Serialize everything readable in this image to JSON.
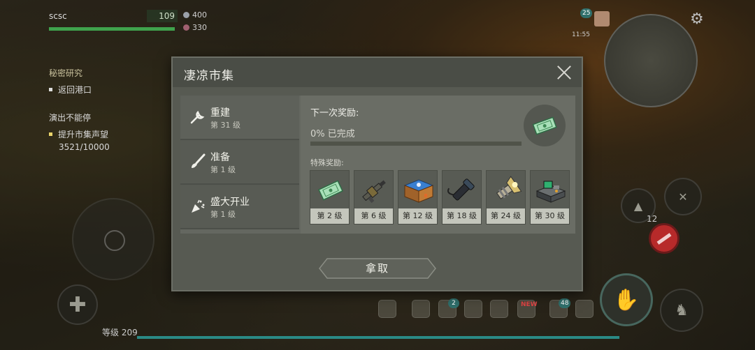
{
  "hud": {
    "player_name": "scsc",
    "health": "109",
    "resource_1": "400",
    "resource_2": "330",
    "quests": [
      {
        "title": "秘密研究",
        "task": "返回港口"
      },
      {
        "title": "演出不能停",
        "task": "提升市集声望",
        "progress": "3521/10000"
      }
    ],
    "promo_badge": "25",
    "promo_timer": "11:55",
    "settings_badge": "",
    "ammo_count": "12",
    "bottom_badges": {
      "mail": "2",
      "event": "NEW",
      "journal": "48"
    },
    "player_level": "等级 209"
  },
  "dialog": {
    "title": "凄凉市集",
    "tabs": [
      {
        "name": "重建",
        "level": "第 31 级",
        "icon": "wrench-icon"
      },
      {
        "name": "准备",
        "level": "第 1 级",
        "icon": "brush-icon"
      },
      {
        "name": "盛大开业",
        "level": "第 1 级",
        "icon": "party-popper-icon"
      }
    ],
    "next_reward_label": "下一次奖励:",
    "progress_text": "0% 已完成",
    "progress_fraction": 0,
    "special_rewards_label": "特殊奖励:",
    "rewards": [
      {
        "level": "第 2 级",
        "icon": "ticket-icon"
      },
      {
        "level": "第 6 级",
        "icon": "grenade-launcher-icon"
      },
      {
        "level": "第 12 级",
        "icon": "blue-crate-icon"
      },
      {
        "level": "第 18 级",
        "icon": "flashlight-icon"
      },
      {
        "level": "第 24 级",
        "icon": "spotlight-icon"
      },
      {
        "level": "第 30 级",
        "icon": "workbench-icon"
      }
    ],
    "take_button": "拿取"
  },
  "colors": {
    "dialog_bg": "#575a52",
    "progress_fill": "#d0c060",
    "health": "#3fa34d",
    "xp": "#2a8a86",
    "danger": "#b72a2a"
  }
}
